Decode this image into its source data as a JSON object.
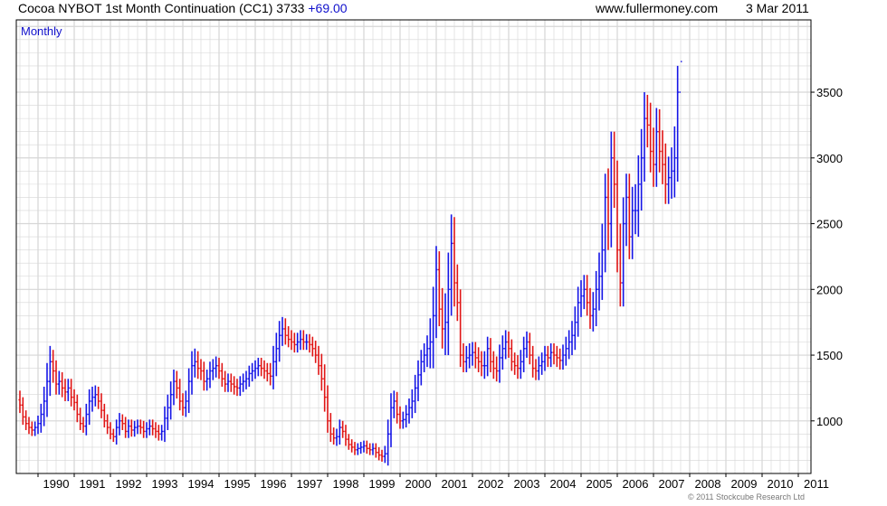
{
  "header": {
    "title": "Cocoa NYBOT 1st Month Continuation (CC1) 3733",
    "change": "+69.00",
    "site": "www.fullermoney.com",
    "date": "3 Mar 2011"
  },
  "period_label": "Monthly",
  "footer": "© 2011 Stockcube Research Ltd",
  "colors": {
    "up": "#1515e6",
    "down": "#e01515",
    "grid": "#d6d6d6",
    "frame": "#000000"
  },
  "chart_data": {
    "type": "bar",
    "title": "Cocoa NYBOT 1st Month Continuation (CC1) 3733",
    "xlabel": "",
    "ylabel": "",
    "x_tick_labels": [
      "1990",
      "1991",
      "1992",
      "1993",
      "1994",
      "1995",
      "1996",
      "1997",
      "1998",
      "1999",
      "2000",
      "2001",
      "2002",
      "2003",
      "2004",
      "2005",
      "2006",
      "2007",
      "2008",
      "2009",
      "2010",
      "2011"
    ],
    "y_ticks": [
      1000,
      1500,
      2000,
      2500,
      3000,
      3500
    ],
    "y_tick_labels": [
      "1000",
      "1500",
      "2000",
      "2500",
      "3000",
      "3500"
    ],
    "ylim": [
      600,
      4050
    ],
    "x_range": [
      1989.4,
      2011.35
    ],
    "grid": true,
    "series": [
      {
        "x_start": 1989.5,
        "x_step": 0.0833333,
        "close": [
          1120,
          1030,
          980,
          950,
          930,
          950,
          980,
          1050,
          1150,
          1300,
          1450,
          1380,
          1280,
          1300,
          1250,
          1220,
          1250,
          1180,
          1140,
          1050,
          980,
          960,
          1050,
          1150,
          1180,
          1200,
          1150,
          1080,
          1000,
          950,
          900,
          880,
          950,
          1000,
          980,
          920,
          960,
          930,
          950,
          960,
          950,
          920,
          940,
          960,
          940,
          920,
          900,
          920,
          1020,
          1100,
          1200,
          1300,
          1250,
          1150,
          1100,
          1150,
          1300,
          1420,
          1450,
          1400,
          1380,
          1300,
          1320,
          1380,
          1400,
          1420,
          1380,
          1320,
          1280,
          1300,
          1280,
          1260,
          1250,
          1280,
          1300,
          1320,
          1360,
          1380,
          1400,
          1420,
          1400,
          1380,
          1360,
          1340,
          1450,
          1550,
          1650,
          1700,
          1650,
          1620,
          1600,
          1580,
          1600,
          1620,
          1600,
          1600,
          1580,
          1550,
          1500,
          1420,
          1320,
          1180,
          1000,
          900,
          870,
          880,
          950,
          920,
          860,
          820,
          800,
          780,
          790,
          800,
          810,
          790,
          780,
          790,
          760,
          740,
          730,
          750,
          900,
          1100,
          1150,
          1050,
          1000,
          1010,
          1050,
          1100,
          1150,
          1250,
          1350,
          1450,
          1500,
          1550,
          1600,
          1800,
          2150,
          1850,
          1700,
          1750,
          2000,
          2350,
          2050,
          1900,
          1500,
          1450,
          1480,
          1500,
          1520,
          1480,
          1450,
          1420,
          1420,
          1550,
          1450,
          1400,
          1380,
          1480,
          1550,
          1600,
          1550,
          1450,
          1420,
          1400,
          1450,
          1550,
          1600,
          1500,
          1400,
          1380,
          1420,
          1450,
          1500,
          1480,
          1520,
          1500,
          1480,
          1460,
          1500,
          1550,
          1600,
          1650,
          1750,
          1900,
          1950,
          2000,
          1900,
          1800,
          1850,
          2000,
          2100,
          2300,
          2700,
          2500,
          3000,
          2800,
          2300,
          2050,
          2500,
          2700,
          2400,
          2600,
          2600,
          2800,
          3000,
          3300,
          3250,
          3050,
          2950,
          3200,
          3050,
          2950,
          2800,
          2850,
          2900,
          3000,
          3500,
          3733
        ],
        "high_offset": [
          70,
          60,
          50,
          50,
          45,
          45,
          60,
          80,
          110,
          140,
          120,
          90,
          80,
          80,
          70,
          70,
          70,
          70,
          60,
          60,
          50,
          50,
          80,
          90,
          80,
          70,
          60,
          60,
          50,
          50,
          40,
          40,
          60,
          60,
          50,
          50,
          50,
          50,
          50,
          50,
          50,
          50,
          50,
          50,
          50,
          50,
          50,
          50,
          90,
          100,
          100,
          90,
          80,
          70,
          60,
          80,
          100,
          110,
          100,
          80,
          70,
          70,
          70,
          70,
          70,
          70,
          60,
          60,
          60,
          60,
          60,
          60,
          60,
          60,
          60,
          60,
          60,
          60,
          60,
          60,
          60,
          60,
          60,
          80,
          120,
          120,
          110,
          90,
          80,
          70,
          70,
          70,
          70,
          70,
          70,
          60,
          60,
          60,
          60,
          70,
          90,
          110,
          90,
          60,
          50,
          60,
          60,
          50,
          50,
          40,
          40,
          40,
          40,
          40,
          40,
          40,
          40,
          40,
          40,
          40,
          40,
          60,
          110,
          110,
          80,
          70,
          60,
          60,
          70,
          70,
          90,
          100,
          110,
          90,
          90,
          100,
          180,
          220,
          180,
          140,
          160,
          220,
          280,
          220,
          200,
          140,
          100,
          90,
          90,
          90,
          80,
          80,
          80,
          80,
          110,
          90,
          80,
          80,
          90,
          100,
          100,
          90,
          80,
          70,
          70,
          80,
          90,
          90,
          80,
          70,
          70,
          70,
          70,
          70,
          70,
          70,
          70,
          70,
          70,
          70,
          80,
          90,
          90,
          110,
          120,
          120,
          120,
          110,
          110,
          110,
          130,
          140,
          180,
          200,
          180,
          220,
          200,
          200,
          180,
          200,
          200,
          180,
          180,
          180,
          200,
          220,
          220,
          200,
          180,
          170,
          180,
          180,
          170,
          160,
          160,
          160,
          180,
          240,
          200
        ],
        "low_offset": [
          60,
          60,
          50,
          50,
          45,
          45,
          50,
          70,
          90,
          120,
          110,
          90,
          80,
          80,
          70,
          70,
          70,
          70,
          60,
          60,
          50,
          50,
          70,
          80,
          80,
          70,
          60,
          60,
          50,
          50,
          40,
          40,
          60,
          60,
          50,
          50,
          50,
          50,
          50,
          50,
          50,
          50,
          50,
          50,
          50,
          50,
          50,
          50,
          80,
          90,
          90,
          80,
          80,
          70,
          60,
          70,
          90,
          100,
          90,
          80,
          70,
          70,
          70,
          70,
          70,
          70,
          60,
          60,
          60,
          60,
          60,
          60,
          60,
          60,
          60,
          60,
          60,
          60,
          60,
          60,
          60,
          60,
          60,
          70,
          100,
          110,
          100,
          80,
          70,
          60,
          60,
          60,
          60,
          60,
          60,
          60,
          60,
          60,
          60,
          70,
          90,
          110,
          90,
          60,
          50,
          60,
          60,
          50,
          50,
          40,
          40,
          40,
          40,
          40,
          40,
          40,
          40,
          40,
          40,
          40,
          40,
          50,
          90,
          100,
          80,
          70,
          60,
          60,
          60,
          70,
          80,
          90,
          100,
          80,
          80,
          90,
          150,
          200,
          170,
          130,
          150,
          200,
          250,
          200,
          180,
          140,
          90,
          80,
          80,
          80,
          80,
          80,
          80,
          80,
          100,
          80,
          80,
          80,
          80,
          90,
          90,
          80,
          70,
          70,
          70,
          80,
          80,
          80,
          70,
          70,
          70,
          70,
          70,
          70,
          70,
          70,
          70,
          70,
          70,
          70,
          70,
          80,
          80,
          100,
          110,
          110,
          110,
          100,
          100,
          100,
          120,
          130,
          160,
          180,
          170,
          200,
          180,
          180,
          170,
          180,
          180,
          170,
          170,
          170,
          180,
          200,
          200,
          180,
          170,
          160,
          170,
          170,
          160,
          150,
          150,
          150,
          160,
          200,
          180
        ]
      }
    ]
  }
}
